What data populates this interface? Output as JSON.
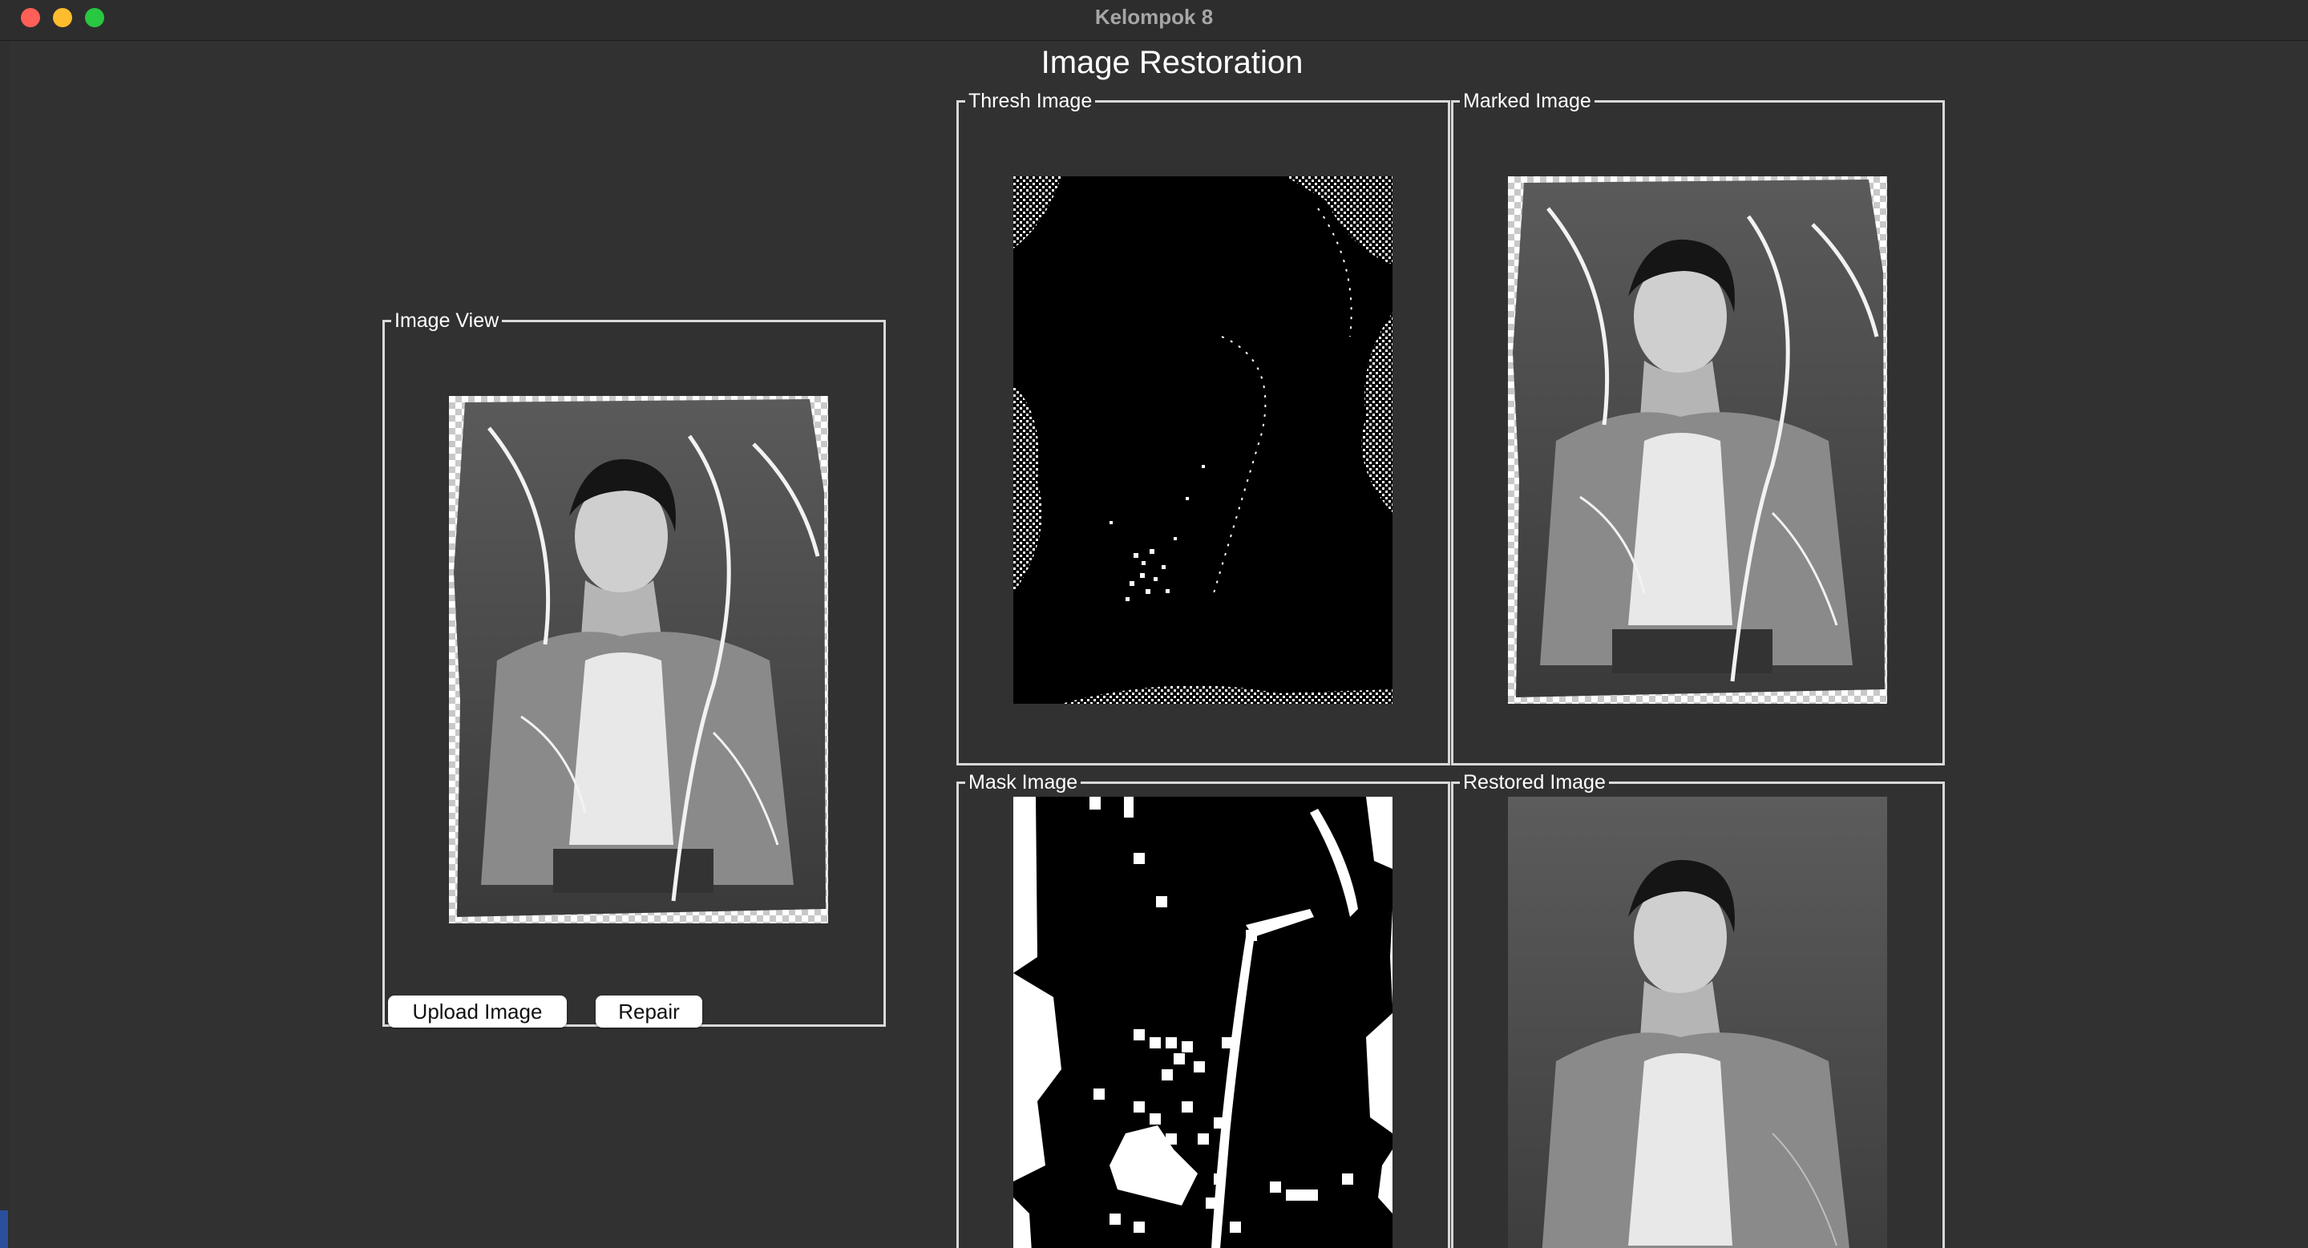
{
  "window": {
    "title": "Kelompok 8"
  },
  "app": {
    "heading": "Image Restoration"
  },
  "panels": {
    "image_view": "Image View",
    "thresh": "Thresh Image",
    "marked": "Marked Image",
    "mask": "Mask Image",
    "restored": "Restored Image"
  },
  "buttons": {
    "upload": "Upload Image",
    "repair": "Repair"
  },
  "colors": {
    "background": "#313131",
    "frame_border": "#d9d9d9",
    "close": "#fe5f57",
    "minimize": "#febc2e",
    "maximize": "#28c840"
  }
}
